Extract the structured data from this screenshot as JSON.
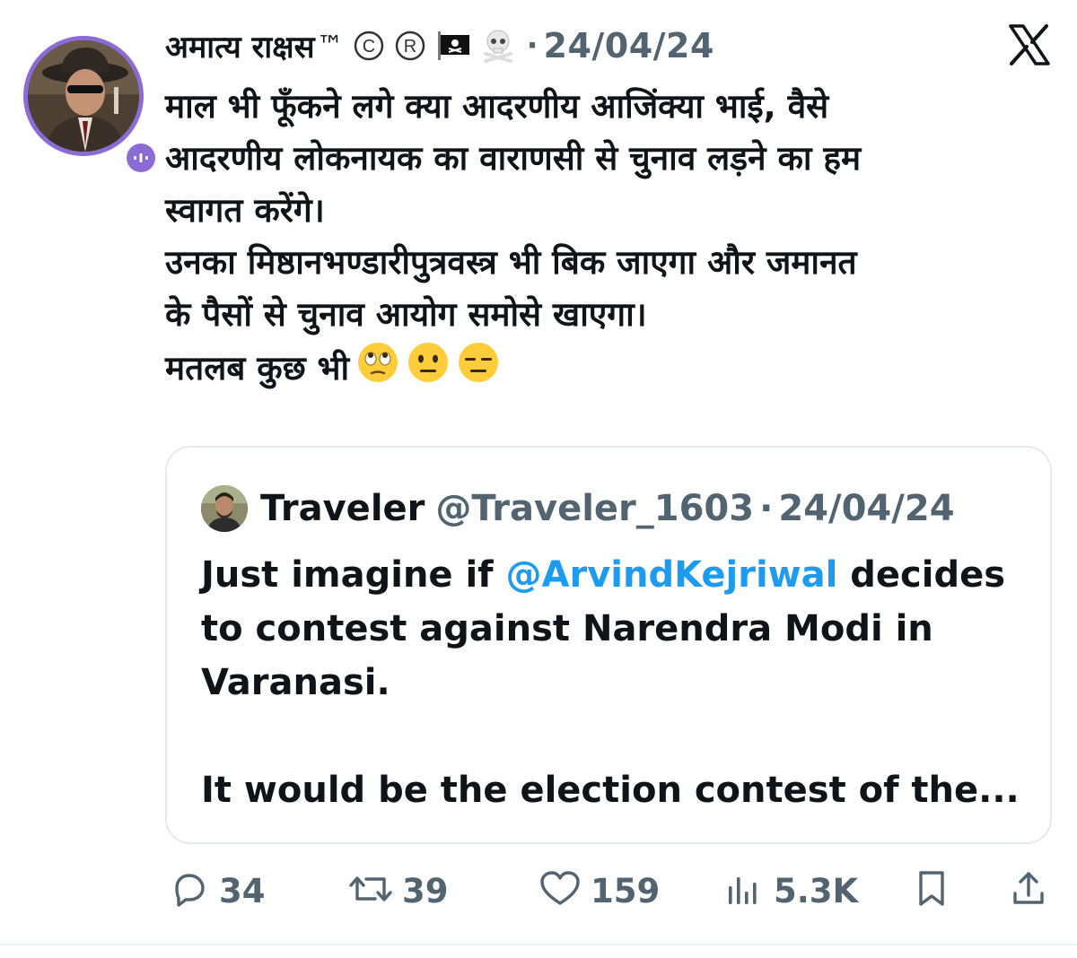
{
  "tweet": {
    "author_name": "अमात्य राक्षस",
    "tm_mark": "™",
    "dot": "·",
    "date": "24/04/24",
    "text_lines": [
      "माल भी फूँकने लगे क्या आदरणीय आजिंक्या भाई, वैसे",
      "आदरणीय लोकनायक का वाराणसी से चुनाव लड़ने का हम",
      "स्वागत करेंगे।",
      "उनका मिष्ठानभण्डारीपुत्रवस्त्र भी बिक जाएगा और जमानत",
      "के पैसों से चुनाव आयोग समोसे खाएगा।",
      "मतलब कुछ भी"
    ],
    "header_icons": [
      "copyright-icon",
      "registered-icon",
      "pirate-flag-icon",
      "skull-crossbones-icon"
    ],
    "trailing_emojis": [
      "face-with-rolling-eyes-icon",
      "neutral-face-icon",
      "expressionless-face-icon"
    ]
  },
  "quote": {
    "name": "Traveler",
    "handle": "@Traveler_1603",
    "dot": "·",
    "date": "24/04/24",
    "text_part1": "Just imagine if ",
    "mention": "@ArvindKejriwal",
    "text_part2": " decides",
    "text_line2": "to contest against Narendra Modi in",
    "text_line3": "Varanasi.",
    "text_line4": "It would be the election contest of the..."
  },
  "actions": {
    "replies": "34",
    "reposts": "39",
    "likes": "159",
    "views": "5.3K"
  },
  "colors": {
    "text": "#0f1419",
    "secondary": "#536471",
    "link": "#1d9bf0",
    "avatar_ring": "#8b6bd6",
    "border": "#e6e9ec"
  }
}
